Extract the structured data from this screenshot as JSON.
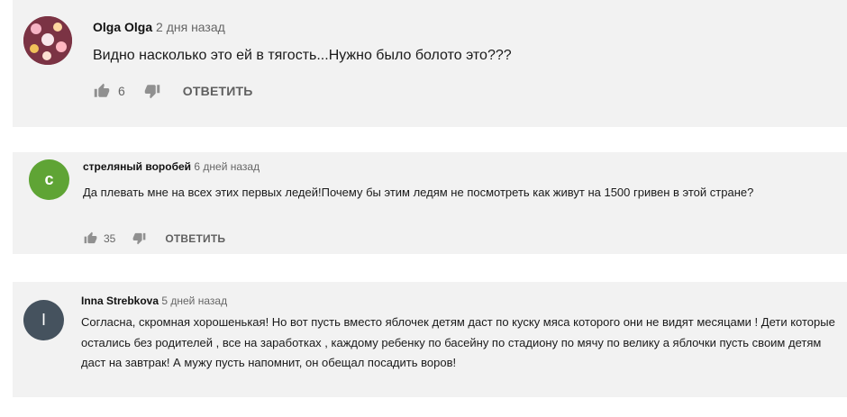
{
  "comments": [
    {
      "author": "Olga Olga",
      "time": "2 дня назад",
      "text": "Видно насколько это ей в тягость...Нужно было болото это???",
      "likes": "6",
      "reply_label": "ОТВЕТИТЬ",
      "avatar_icon": "hearts-avatar-icon"
    },
    {
      "author": "стреляный воробей",
      "time": "6 дней назад",
      "text": "Да плевать мне на всех этих первых ледей!Почему бы этим ледям не посмотреть как живут на 1500 гривен в этой стране?",
      "likes": "35",
      "reply_label": "ОТВЕТИТЬ",
      "avatar_letter": "с",
      "avatar_color": "#5fa435"
    },
    {
      "author": "Inna Strebkova",
      "time": "5 дней назад",
      "text": "Согласна, скромная  хорошенькая! Но вот пусть вместо яблочек детям  даст по куску мяса которого они не видят месяцами ! Дети которые остались без родителей  , все на заработках , каждому ребенку по басейну по стадиону по мячу по велику а яблочки пусть своим детям даст на завтрак! А мужу пусть напомнит, он обещал посадить воров!",
      "avatar_letter": "I",
      "avatar_color": "#45525e"
    }
  ]
}
